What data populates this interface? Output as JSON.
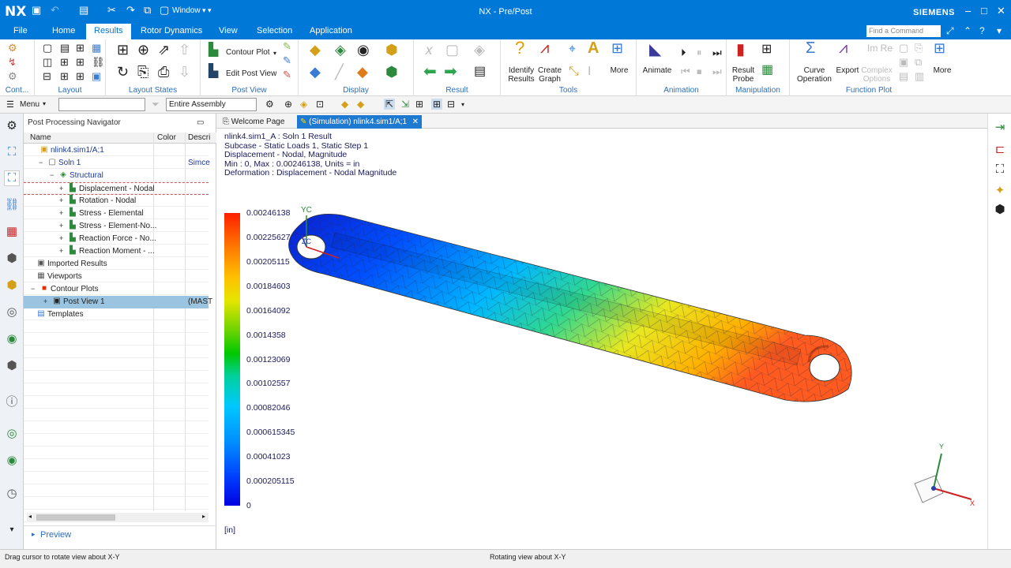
{
  "app": {
    "logo": "NX",
    "window_menu": "Window",
    "title": "NX - Pre/Post",
    "brand": "SIEMENS"
  },
  "menu_tabs": [
    "File",
    "Home",
    "Results",
    "Rotor Dynamics",
    "View",
    "Selection",
    "Application"
  ],
  "find_placeholder": "Find a Command",
  "ribbon": {
    "groups": {
      "context": "Cont...",
      "layout": "Layout",
      "layout_states": "Layout States",
      "post_view": "Post View",
      "display": "Display",
      "result": "Result",
      "tools": "Tools",
      "animation": "Animation",
      "manipulation": "Manipulation",
      "function_plot": "Function Plot"
    },
    "buttons": {
      "contour_plot": "Contour Plot",
      "edit_post_view": "Edit Post View",
      "identify": "Identify",
      "results": "Results",
      "create": "Create",
      "graph": "Graph",
      "more_tools": "More",
      "animate": "Animate",
      "result_probe_1": "Result",
      "result_probe_2": "Probe",
      "curve_1": "Curve",
      "curve_2": "Operation",
      "export": "Export",
      "complex_1": "Complex",
      "complex_2": "Options",
      "more_fn": "More"
    }
  },
  "cmdbar": {
    "menu_label": "Menu",
    "filter_value": "",
    "scope_value": "Entire Assembly"
  },
  "navigator": {
    "title": "Post Processing Navigator",
    "columns": {
      "name": "Name",
      "color": "Color",
      "desc": "Descri"
    },
    "rows": [
      {
        "label": "nlink4.sim1/A;1",
        "desc": ""
      },
      {
        "label": "Soln 1",
        "desc": "Simce"
      },
      {
        "label": "Structural",
        "desc": ""
      },
      {
        "label": "Displacement - Nodal",
        "desc": ""
      },
      {
        "label": "Rotation - Nodal",
        "desc": ""
      },
      {
        "label": "Stress - Elemental",
        "desc": ""
      },
      {
        "label": "Stress - Element-No...",
        "desc": ""
      },
      {
        "label": "Reaction Force - No...",
        "desc": ""
      },
      {
        "label": "Reaction Moment - ...",
        "desc": ""
      },
      {
        "label": "Imported Results",
        "desc": ""
      },
      {
        "label": "Viewports",
        "desc": ""
      },
      {
        "label": "Contour Plots",
        "desc": ""
      },
      {
        "label": "Post View 1",
        "desc": "(MAST"
      },
      {
        "label": "Templates",
        "desc": ""
      }
    ],
    "preview": "Preview"
  },
  "view_tabs": [
    {
      "label": "Welcome Page",
      "active": false
    },
    {
      "label": "(Simulation) nlink4.sim1/A;1",
      "active": true
    }
  ],
  "result_info": [
    "nlink4.sim1_A : Soln 1 Result",
    "Subcase - Static Loads 1, Static Step 1",
    "Displacement - Nodal, Magnitude",
    "Min : 0, Max : 0.00246138, Units = in",
    "Deformation : Displacement - Nodal Magnitude"
  ],
  "legend": {
    "values": [
      "0.00246138",
      "0.00225627",
      "0.00205115",
      "0.00184603",
      "0.00164092",
      "0.0014358",
      "0.00123069",
      "0.00102557",
      "0.00082046",
      "0.000615345",
      "0.00041023",
      "0.000205115",
      "0"
    ],
    "units": "[in]"
  },
  "axis_labels": {
    "yc": "YC",
    "zc": "ZC",
    "x": "X",
    "y": "Y"
  },
  "status": {
    "left": "Drag cursor to rotate view about X-Y",
    "center": "Rotating view about X-Y"
  },
  "colors": {
    "title_blue": "#0078d7",
    "selected_row": "#9ac4df",
    "active_tab": "#1e7ad1"
  }
}
